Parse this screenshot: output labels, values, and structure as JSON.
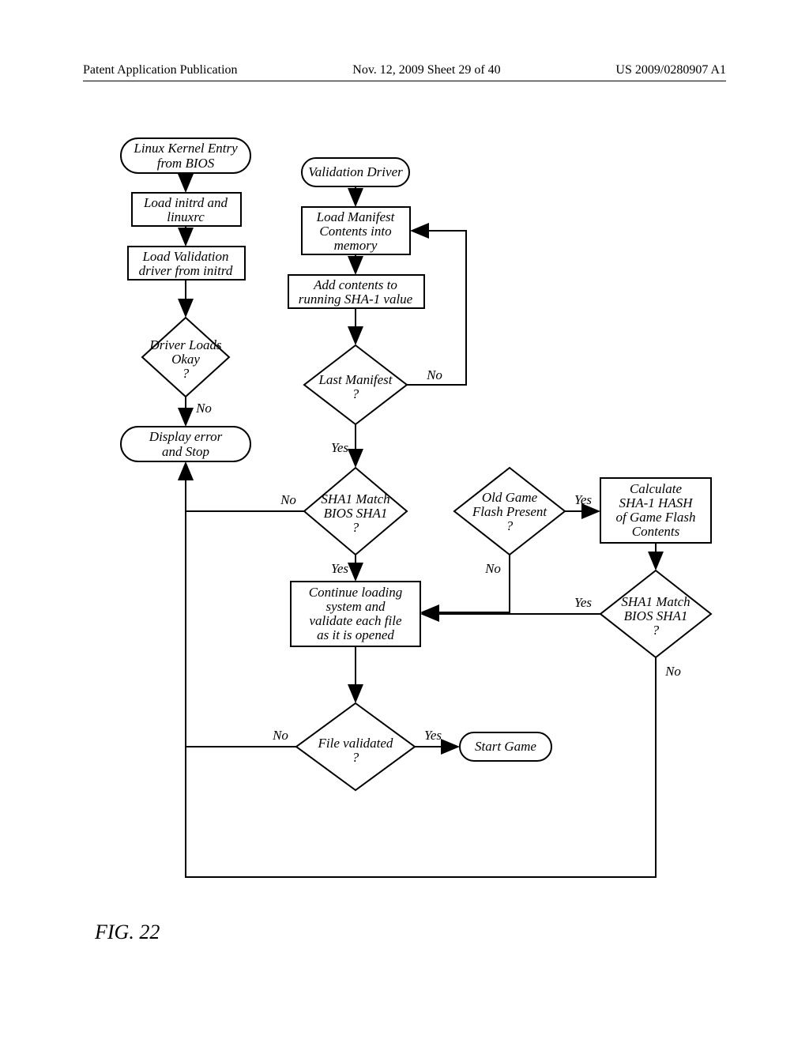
{
  "header": {
    "left": "Patent Application Publication",
    "center": "Nov. 12, 2009  Sheet 29 of 40",
    "right": "US 2009/0280907 A1"
  },
  "fig_caption": "FIG. 22",
  "nodes": {
    "entry": {
      "l1": "Linux Kernel Entry",
      "l2": "from BIOS"
    },
    "load_initrd": {
      "l1": "Load initrd and",
      "l2": "linuxrc"
    },
    "load_valdrv": {
      "l1": "Load Validation",
      "l2": "driver from initrd"
    },
    "driver_loads": {
      "l1": "Driver Loads",
      "l2": "Okay",
      "l3": "?"
    },
    "display_error": {
      "l1": "Display error",
      "l2": "and Stop"
    },
    "validation_driver": "Validation Driver",
    "load_manifest": {
      "l1": "Load Manifest",
      "l2": "Contents into",
      "l3": "memory"
    },
    "add_sha": {
      "l1": "Add contents to",
      "l2": "running SHA-1 value"
    },
    "last_manifest": {
      "l1": "Last Manifest",
      "l2": "?"
    },
    "sha1_match1": {
      "l1": "SHA1 Match",
      "l2": "BIOS SHA1",
      "l3": "?"
    },
    "old_game": {
      "l1": "Old Game",
      "l2": "Flash Present",
      "l3": "?"
    },
    "calc_sha": {
      "l1": "Calculate",
      "l2": "SHA-1 HASH",
      "l3": "of Game Flash",
      "l4": "Contents"
    },
    "sha1_match2": {
      "l1": "SHA1 Match",
      "l2": "BIOS SHA1",
      "l3": "?"
    },
    "continue_load": {
      "l1": "Continue loading",
      "l2": "system and",
      "l3": "validate each file",
      "l4": "as it is opened"
    },
    "file_validated": {
      "l1": "File validated",
      "l2": "?"
    },
    "start_game": "Start Game"
  },
  "labels": {
    "yes": "Yes",
    "no": "No"
  }
}
